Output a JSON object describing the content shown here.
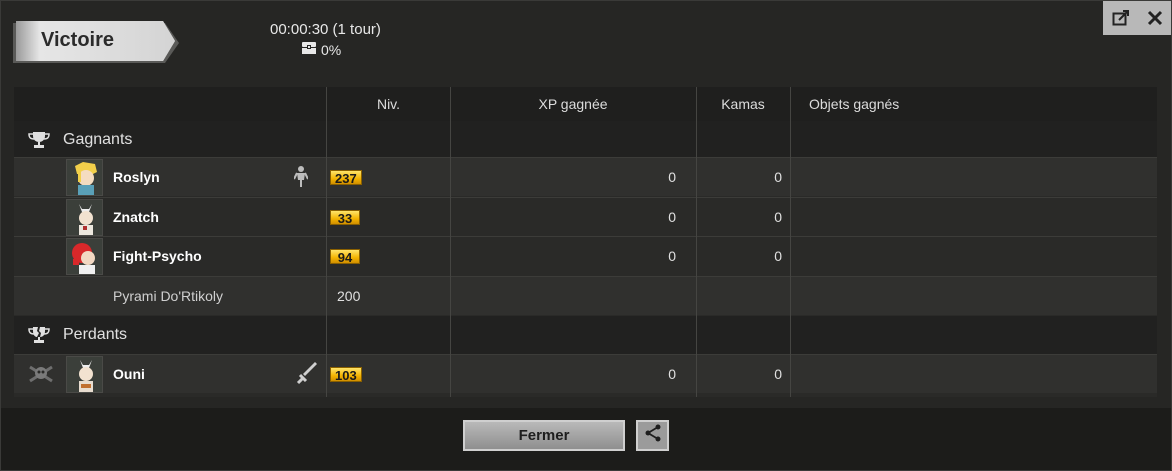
{
  "result": {
    "title": "Victoire",
    "duration": "00:00:30 (1 tour)",
    "chest_percent": "0%"
  },
  "columns": [
    "Niv.",
    "XP gagnée",
    "Kamas",
    "Objets gagnés"
  ],
  "winners": {
    "label": "Gagnants",
    "players": [
      {
        "name": "Roslyn",
        "level": "237",
        "xp": "0",
        "kamas": "0"
      },
      {
        "name": "Znatch",
        "level": "33",
        "xp": "0",
        "kamas": "0"
      },
      {
        "name": "Fight-Psycho",
        "level": "94",
        "xp": "0",
        "kamas": "0"
      }
    ],
    "summon": {
      "name": "Pyrami Do'Rtikoly",
      "level": "200"
    }
  },
  "losers": {
    "label": "Perdants",
    "players": [
      {
        "name": "Ouni",
        "level": "103",
        "xp": "0",
        "kamas": "0"
      }
    ]
  },
  "footer": {
    "close_label": "Fermer"
  },
  "colors": {
    "level_badge": "#f3b300",
    "background": "#262624"
  }
}
